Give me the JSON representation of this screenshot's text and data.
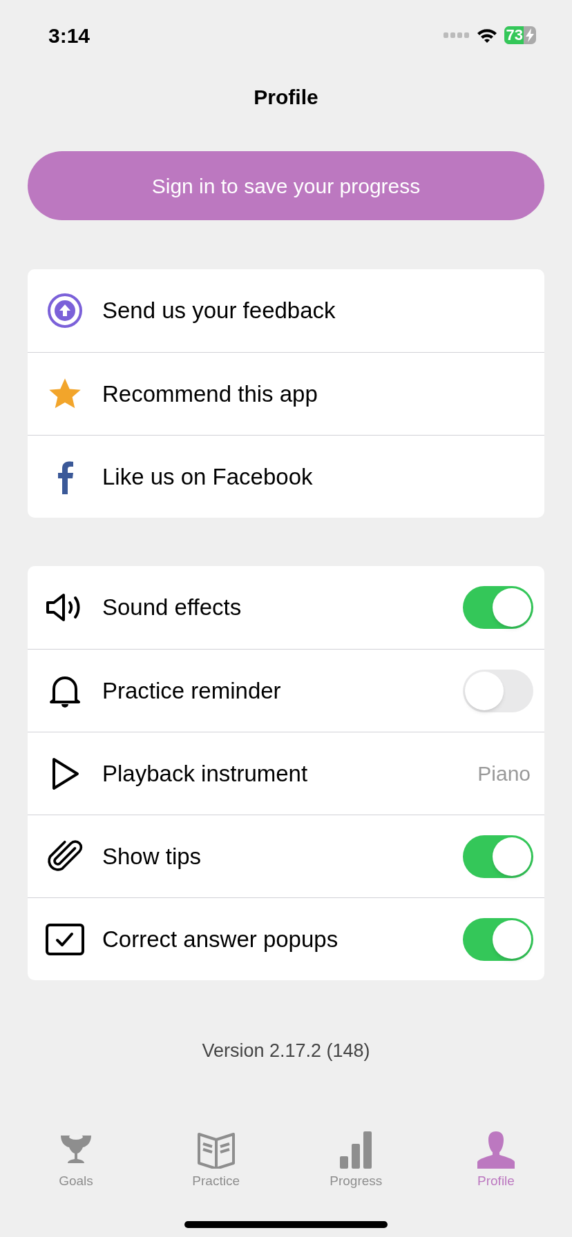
{
  "status_bar": {
    "time": "3:14",
    "battery": "73"
  },
  "title": "Profile",
  "sign_in_button": "Sign in to save your progress",
  "links": [
    {
      "label": "Send us your feedback"
    },
    {
      "label": "Recommend this app"
    },
    {
      "label": "Like us on Facebook"
    }
  ],
  "settings": [
    {
      "kind": "toggle",
      "label": "Sound effects",
      "on": true
    },
    {
      "kind": "toggle",
      "label": "Practice reminder",
      "on": false
    },
    {
      "kind": "value",
      "label": "Playback instrument",
      "value": "Piano"
    },
    {
      "kind": "toggle",
      "label": "Show tips",
      "on": true
    },
    {
      "kind": "toggle",
      "label": "Correct answer popups",
      "on": true
    }
  ],
  "version": "Version 2.17.2 (148)",
  "tabs": [
    {
      "label": "Goals",
      "selected": false
    },
    {
      "label": "Practice",
      "selected": false
    },
    {
      "label": "Progress",
      "selected": false
    },
    {
      "label": "Profile",
      "selected": true
    }
  ]
}
